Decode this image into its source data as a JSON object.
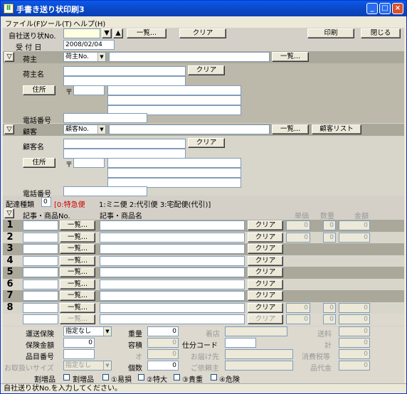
{
  "window": {
    "title": "手書き送り状印刷3",
    "icon_text": "Ⅱ",
    "minimize": "_",
    "maximize": "□",
    "close": "×"
  },
  "menu": [
    "ファイル(F)",
    "ツール(T)",
    "ヘルプ(H)"
  ],
  "top": {
    "label_invoice": "自社送り状No.",
    "invoice_value": "",
    "down_arrow": "▼",
    "up_arrow": "▲",
    "list_btn": "一覧...",
    "clear_btn": "クリア",
    "print_btn": "印刷",
    "close_btn": "閉じる",
    "label_date": "受 付 日",
    "date_value": "2008/02/04"
  },
  "shipper": {
    "toggle": "▽",
    "section_label": "荷主",
    "select_value": "荷主No.",
    "code_value": "",
    "list_btn": "一覧...",
    "name_label": "荷主名",
    "clear_btn": "クリア",
    "address_btn": "住所",
    "postal_mark": "〒",
    "phone_label": "電話番号"
  },
  "customer": {
    "toggle": "▽",
    "section_label": "顧客",
    "select_value": "顧客No.",
    "code_value": "",
    "list_btn": "一覧...",
    "list2_btn": "顧客リスト",
    "name_label": "顧客名",
    "clear_btn": "クリア",
    "address_btn": "住所",
    "postal_mark": "〒",
    "phone_label": "電話番号"
  },
  "delivery": {
    "label": "配達種類",
    "value": "0",
    "opt0": "[0:特急便",
    "opt_rest": "1:ミニ便  2:代引便  3:宅配便(代引)]"
  },
  "items": {
    "toggle": "▽",
    "col_code": "記事・商品No.",
    "col_name": "記事・商品名",
    "col_price": "単価",
    "col_qty": "数量",
    "col_amount": "金額",
    "list_btn": "一覧...",
    "clear_btn": "クリア",
    "zero": "0",
    "rows": [
      "1",
      "2",
      "3",
      "4",
      "5",
      "6",
      "7",
      "8",
      ""
    ]
  },
  "bottom": {
    "insurance_label": "運送保険",
    "insurance_value": "指定なし",
    "amount_label": "保険金額",
    "amount_value": "0",
    "product_label": "品目番号",
    "size_label": "お取扱いサイズ",
    "size_value": "指定なし",
    "weight_label": "重量",
    "weight_value": "0",
    "volume_label": "容積",
    "volume_value": "0",
    "o_label": "オ",
    "o_value": "0",
    "count_label": "個数",
    "count_value": "0",
    "arrive_label": "着店",
    "sort_label": "仕分コード",
    "dest_label": "お届け先",
    "client_label": "ご依頼主",
    "fee_label": "送料",
    "fee_value": "0",
    "total_label": "計",
    "total_value": "0",
    "tax_label": "消費税等",
    "tax_value": "0",
    "product_fee_label": "品代金",
    "product_fee_value": "0",
    "extra_label": "割増品",
    "chk1": "割増品",
    "chk2": "①易損",
    "chk3": "②特大",
    "chk4": "③貴重",
    "chk5": "④危険"
  },
  "status": "自社送り状No.を入力してください。"
}
